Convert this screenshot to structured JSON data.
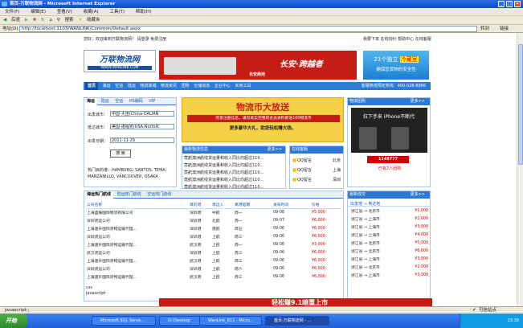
{
  "window": {
    "title": "首页-万联物流网 - Microsoft Internet Explorer",
    "menu": [
      "文件(F)",
      "编辑(E)",
      "查看(V)",
      "收藏(A)",
      "工具(T)",
      "帮助(H)"
    ],
    "toolbar": [
      "后退",
      "搜索",
      "收藏夹"
    ],
    "address_label": "地址(D)",
    "address": "http://localhost:1103/WANLINK/Common/Default.aspx",
    "go_label": "转到",
    "links_label": "链接"
  },
  "page": {
    "welcome": "您好，欢迎来到万联物流网！ 请登录 免费注册",
    "top_links": "我要下单  在线询价  帮助中心  在线客服",
    "logo_text": "万联物流网",
    "logo_url": "WWW.WANLINK.COM",
    "banner_text": "长安·跨越者",
    "banner_sub": "长安商用",
    "side_banner_line1": "21个独立",
    "side_banner_hl": "冷藏室",
    "side_banner_line2": "确保您货物的安全性",
    "nav": [
      "首页",
      "海运",
      "空运",
      "陆运",
      "物流商城",
      "物流资讯",
      "团购",
      "仓储动态",
      "企业中心",
      "实用工具"
    ],
    "hotline": "客服热线预定热线：400-028-8866",
    "search_tabs": [
      "海运",
      "陆运",
      "空运",
      "HS编码",
      "VIP"
    ],
    "from_label": "出发城市：",
    "from_value": "中国-大连(China-DALIAN",
    "to_label": "抵达城市：",
    "to_value": "美国-诺福克(USA-Norfolk",
    "date_label": "出发日期：",
    "date_value": "2011-11-29",
    "search_button": "搜 索",
    "hot_ports": "热门目的港：HAMBURG, SANTOS, TEMA, MANZANILLO, VANCOUVER, OSAKA",
    "promo_title": "物流币大放送",
    "promo_line1": "完善注册信息，填写真实完整的会员资料即送100物流币",
    "promo_line2": "更多豪华大礼，助您轻松赚大钱。",
    "info_title": "最新物流信息",
    "info_more": "更多>>",
    "info_items": [
      "竟航澳洲航线货运量和收入同比均超过110...",
      "竟航澳洲航线货运量和收入同比均超过110...",
      "竟航澳洲航线货运量和收入同比均超过110...",
      "竟航澳洲航线货运量和收入同比均超过110...",
      "竟航澳洲航线货运量和收入同比均超过110..."
    ],
    "service_title": "在线客服",
    "service_items": [
      {
        "name": "QQ留言",
        "city": "北京"
      },
      {
        "name": "QQ留言",
        "city": "上海"
      },
      {
        "name": "QQ留言",
        "city": "深圳"
      }
    ],
    "tuangou_title": "物流团购",
    "tuangou_more": "更多>>",
    "tuangou_ad": "拉下手来 iPhone不断代",
    "tuangou_price": "1148777",
    "tuangou_caption": "已有2人团购",
    "route_tabs": [
      "海运热门航线",
      "陆运热门航线",
      "空运热门航线"
    ],
    "table_headers": [
      "公司名称",
      "目的港",
      "承运人",
      "离港船期",
      "发布时间",
      "价格"
    ],
    "table_rows": [
      [
        "上海盛振国际物流有限公司",
        "深圳港",
        "中航",
        "周一",
        "09-08",
        "¥5,000"
      ],
      [
        "深圳货运公司",
        "深圳港",
        "北航",
        "周一",
        "09-07",
        "¥6,000"
      ],
      [
        "上海速升国际货物运输代理...",
        "深圳港",
        "南航",
        "周五",
        "09-06",
        "¥6,000"
      ],
      [
        "深圳货运公司",
        "深圳港",
        "上航",
        "周三",
        "09-06",
        "¥6,000"
      ],
      [
        "上海速升国际货物运输代理...",
        "武汉港",
        "上航",
        "周一",
        "09-06",
        "¥3,000"
      ],
      [
        "武汉货运公司",
        "深圳港",
        "上航",
        "周三",
        "09-06",
        "¥6,000"
      ],
      [
        "上海速升国际货物运输代理...",
        "武汉港",
        "上航",
        "周三",
        "09-06",
        "¥6,000"
      ],
      [
        "深圳货运公司",
        "深圳港",
        "上航",
        "周六",
        "09-06",
        "¥6,000"
      ],
      [
        "上海速升国际货物运输代理...",
        "武汉港",
        "上航",
        "周三",
        "09-06",
        "¥6,000"
      ]
    ],
    "footer_css": "css",
    "footer_js": "javascript",
    "deal_title": "最新成交",
    "deal_more": "更多>>",
    "deal_header": "出发地 → 到达地",
    "deals": [
      [
        "浙江省 → 北京市",
        "¥1,000"
      ],
      [
        "浙江省 → 上海市",
        "¥2,000"
      ],
      [
        "浙江省 → 上海市",
        "¥3,000"
      ],
      [
        "浙江省 → 上海市",
        "¥4,000"
      ],
      [
        "浙江省 → 北京市",
        "¥5,000"
      ],
      [
        "浙江省 → 北京市",
        "¥6,000"
      ],
      [
        "浙江省 → 上海市",
        "¥3,000"
      ],
      [
        "浙江省 → 北京市",
        "¥2,000"
      ],
      [
        "浙江省 → 上海市",
        "¥3,000"
      ]
    ],
    "bottom_banner": "轻松赚9.1暗重上市"
  },
  "status": {
    "left": "javascript:;",
    "right": "可信站点"
  },
  "taskbar": {
    "start": "开始",
    "items": [
      "Microsoft SQL Serve...",
      "D:\\Desktop",
      "WanLink_B11 - Micro...",
      "首页-万联物流网 - ..."
    ],
    "clock": "23:39"
  },
  "colors": {
    "accent": "#2d78d5",
    "price": "#d40000",
    "banner": "#c51d16"
  }
}
